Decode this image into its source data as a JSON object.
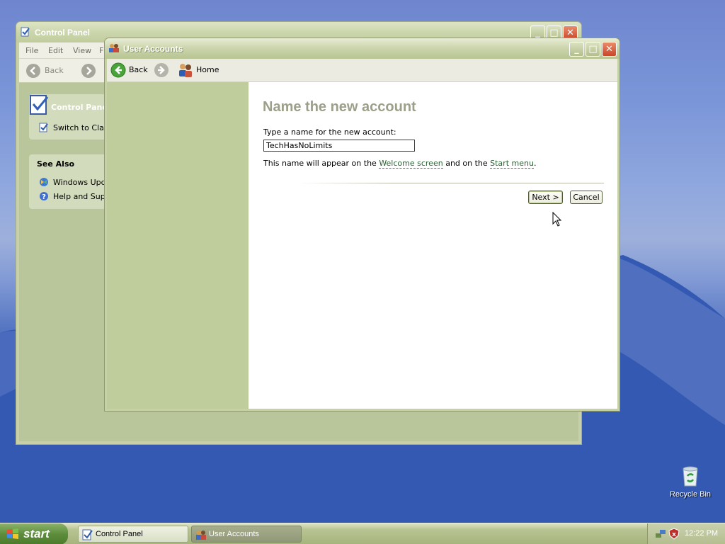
{
  "desktop": {
    "recycle_bin_label": "Recycle Bin"
  },
  "control_panel_window": {
    "title": "Control Panel",
    "menu": [
      "File",
      "Edit",
      "View",
      "F"
    ],
    "back_label": "Back",
    "panel_title": "Control Panel",
    "switch_view": "Switch to Class",
    "see_also_title": "See Also",
    "see_also_items": [
      "Windows Updat",
      "Help and Suppo"
    ]
  },
  "user_accounts_window": {
    "title": "User Accounts",
    "toolbar": {
      "back_label": "Back",
      "home_label": "Home"
    },
    "heading": "Name the new account",
    "input_label": "Type a name for the new account:",
    "input_value": "TechHasNoLimits",
    "hint": {
      "prefix": "This name will appear on the ",
      "link1": "Welcome screen",
      "middle": " and on the ",
      "link2": "Start menu",
      "suffix": "."
    },
    "next_label": "Next >",
    "cancel_label": "Cancel"
  },
  "taskbar": {
    "start_label": "start",
    "tasks": [
      {
        "label": "Control Panel",
        "active": false
      },
      {
        "label": "User Accounts",
        "active": true
      }
    ],
    "clock": "12:22 PM"
  },
  "colors": {
    "theme_olive": "#b9c59a",
    "desktop_blue": "#2f54ad",
    "heading_gray": "#9c9f89"
  }
}
